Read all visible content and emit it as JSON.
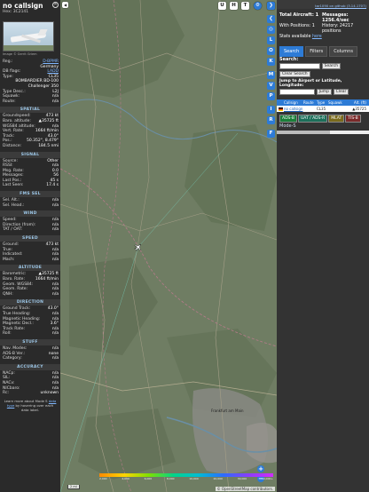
{
  "aircraft": {
    "callsign": "no callsign",
    "hex_label": "Hex:",
    "hex": "3C2141",
    "photo_credit": "Image © Gerrit Griem"
  },
  "info_rows": [
    {
      "k": "Reg.:",
      "v": "D-BPMR",
      "link": true
    },
    {
      "k": "",
      "v": "Germany"
    },
    {
      "k": "DB flags:",
      "v": "LADD",
      "link": true
    },
    {
      "k": "Type:",
      "v": "CL35"
    },
    {
      "k": "",
      "v": "BOMBARDIER BD-100"
    },
    {
      "k": "",
      "v": "Challenger 350"
    },
    {
      "k": "Type Desc.:",
      "v": "L2J"
    },
    {
      "k": "Squawk:",
      "v": "n/a"
    },
    {
      "k": "Route:",
      "v": "n/a"
    }
  ],
  "sections": [
    {
      "title": "SPATIAL",
      "rows": [
        {
          "k": "Groundspeed:",
          "v": "473 kt"
        },
        {
          "k": "Baro. altitude:",
          "v": "▲35725 ft"
        },
        {
          "k": "WGS84 altitude:",
          "v": "n/a"
        },
        {
          "k": "Vert. Rate:",
          "v": "1664 ft/min"
        },
        {
          "k": "Track:",
          "v": "43.0°"
        },
        {
          "k": "Pos.:",
          "v": "50.352°, 8.479°"
        },
        {
          "k": "Distance:",
          "v": "184.5 nmi"
        }
      ]
    },
    {
      "title": "SIGNAL",
      "rows": [
        {
          "k": "Source:",
          "v": "Other"
        },
        {
          "k": "RSSI:",
          "v": "n/a"
        },
        {
          "k": "Msg. Rate:",
          "v": "0.0"
        },
        {
          "k": "Messages:",
          "v": "56"
        },
        {
          "k": "Last Pos.:",
          "v": "45 s"
        },
        {
          "k": "Last Seen:",
          "v": "17.4 s"
        }
      ]
    },
    {
      "title": "FMS SEL",
      "rows": [
        {
          "k": "Sel. Alt.:",
          "v": "n/a"
        },
        {
          "k": "Sel. Head.:",
          "v": "n/a"
        }
      ]
    },
    {
      "title": "WIND",
      "rows": [
        {
          "k": "Speed:",
          "v": "n/a"
        },
        {
          "k": "Direction (from):",
          "v": "n/a"
        },
        {
          "k": "TAT / OAT:",
          "v": "n/a"
        }
      ]
    },
    {
      "title": "SPEED",
      "rows": [
        {
          "k": "Ground:",
          "v": "473 kt"
        },
        {
          "k": "True:",
          "v": "n/a"
        },
        {
          "k": "Indicated:",
          "v": "n/a"
        },
        {
          "k": "Mach:",
          "v": "n/a"
        }
      ]
    },
    {
      "title": "ALTITUDE",
      "rows": [
        {
          "k": "Barometric:",
          "v": "▲35725 ft"
        },
        {
          "k": "Baro. Rate:",
          "v": "1664 ft/min"
        },
        {
          "k": "Geom. WGS84:",
          "v": "n/a"
        },
        {
          "k": "Geom. Rate:",
          "v": "n/a"
        },
        {
          "k": "QNH:",
          "v": "n/a"
        }
      ]
    },
    {
      "title": "DIRECTION",
      "rows": [
        {
          "k": "Ground Track:",
          "v": "43.0°"
        },
        {
          "k": "True Heading:",
          "v": "n/a"
        },
        {
          "k": "Magnetic Heading:",
          "v": "n/a"
        },
        {
          "k": "Magnetic Decl.:",
          "v": "3.6°"
        },
        {
          "k": "Track Rate:",
          "v": "n/a"
        },
        {
          "k": "Roll:",
          "v": "n/a"
        }
      ]
    },
    {
      "title": "STUFF",
      "rows": [
        {
          "k": "Nav. Modes:",
          "v": "n/a"
        },
        {
          "k": "ADS-B Ver.:",
          "v": "none"
        },
        {
          "k": "Category:",
          "v": "n/a"
        }
      ]
    },
    {
      "title": "ACCURACY",
      "rows": [
        {
          "k": "NACp:",
          "v": "n/a"
        },
        {
          "k": "SIL:",
          "v": "n/a"
        },
        {
          "k": "NACv:",
          "v": "n/a"
        },
        {
          "k": "NICbaro:",
          "v": "n/a"
        },
        {
          "k": "Rc:",
          "v": "unknown"
        }
      ]
    }
  ],
  "learn": {
    "pre": "Learn more about Mode S",
    "mid": "data type",
    "post": "by hovering over each data label."
  },
  "map": {
    "top_buttons": [
      "U",
      "H",
      "T"
    ],
    "side_buttons": [
      "L",
      "O",
      "K",
      "M",
      "P",
      "I",
      "R",
      "F"
    ],
    "layer_buttons": [
      "V"
    ],
    "zoom_in": "+",
    "zoom_out": "−",
    "scale": "2 mi",
    "attribution": "© OpenStreetMap contributors.",
    "city_label": "Frankfurt am Main",
    "colorbar_labels": [
      "2,000",
      "4,000",
      "6,000",
      "8,000",
      "10,000",
      "20,000",
      "30,000",
      "40,000+"
    ]
  },
  "right": {
    "top_link": "tar1090 on github (3.14.1707)",
    "total_label": "Total Aircraft:",
    "total": "1",
    "msgs_label": "Messages:",
    "msgs": "1256.4/sec",
    "pos_label": "With Positions:",
    "pos": "1",
    "hist_label": "History:",
    "hist": "24217 positions",
    "stats_label": "Stats available",
    "stats_link": "here",
    "tabs": [
      "Search",
      "Filters",
      "Columns"
    ],
    "search_label": "Search:",
    "search_btn": "Search",
    "clear_search": "Clear Search",
    "jump_label": "Jump to Airport or Latitude, Longitude:",
    "jump_btn": "Jump",
    "clear_btn": "Clear",
    "table_headers": [
      "Callsign",
      "Route",
      "Type",
      "Squawk",
      "Alt. (ft)"
    ],
    "table_row": {
      "callsign": "no callsign",
      "route": "",
      "type": "CL35",
      "squawk": "",
      "alt": "▲35725"
    },
    "tags": [
      "ADS-B",
      "UAT / ADS-R",
      "MLAT",
      "TIS-B"
    ],
    "tag_colors": [
      "#1b7f3a",
      "#1d6f5a",
      "#7a6a1c",
      "#7a2a2a"
    ],
    "modes": "Mode-S"
  },
  "colors": {
    "accent": "#2d7bd6",
    "section_text": "#9cc7e8",
    "map_bg": "#6b7a60",
    "link": "#7fb7ff"
  }
}
